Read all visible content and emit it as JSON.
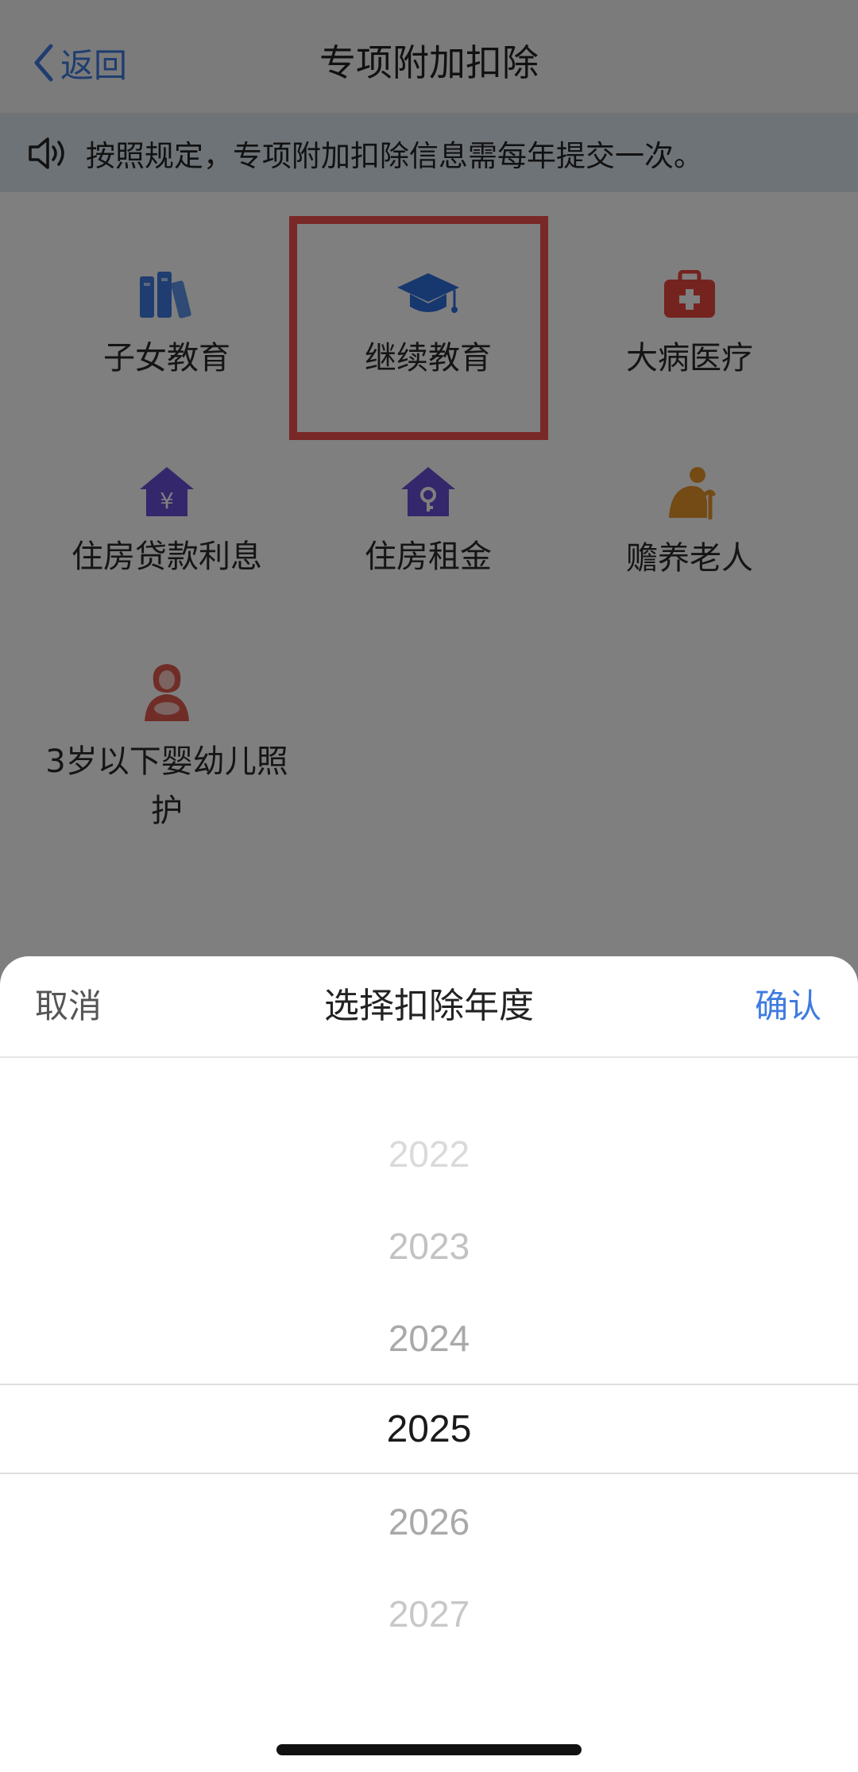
{
  "nav": {
    "back_label": "返回",
    "title": "专项附加扣除"
  },
  "notice": {
    "icon": "speaker-icon",
    "text": "按照规定，专项附加扣除信息需每年提交一次。"
  },
  "categories": [
    {
      "label": "子女教育",
      "icon": "books-icon",
      "color": "#3f7be0"
    },
    {
      "label": "继续教育",
      "icon": "graduation-cap-icon",
      "color": "#2f6fdf",
      "highlighted": true
    },
    {
      "label": "大病医疗",
      "icon": "medical-kit-icon",
      "color": "#e8463c"
    },
    {
      "label": "住房贷款利息",
      "icon": "house-yen-icon",
      "color": "#6b4fd6",
      "glyph": "¥"
    },
    {
      "label": "住房租金",
      "icon": "house-key-icon",
      "color": "#6b4fd6"
    },
    {
      "label": "赡养老人",
      "icon": "elderly-person-icon",
      "color": "#e8952a"
    },
    {
      "label": "3岁以下婴幼儿照护",
      "icon": "mother-baby-icon",
      "color": "#e05a4e"
    }
  ],
  "picker": {
    "cancel_label": "取消",
    "title": "选择扣除年度",
    "confirm_label": "确认",
    "years": [
      "2022",
      "2023",
      "2024",
      "2025",
      "2026",
      "2027"
    ],
    "selected": "2025"
  },
  "colors": {
    "accent": "#3f7be0",
    "highlight": "#f25050"
  }
}
